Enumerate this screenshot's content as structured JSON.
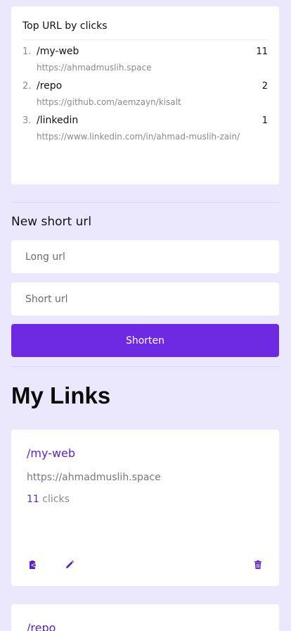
{
  "top_urls": {
    "title": "Top URL by clicks",
    "items": [
      {
        "rank": "1.",
        "path": "/my-web",
        "count": "11",
        "url": "https://ahmadmuslih.space"
      },
      {
        "rank": "2.",
        "path": "/repo",
        "count": "2",
        "url": "https://github.com/aemzayn/kisalt"
      },
      {
        "rank": "3.",
        "path": "/linkedin",
        "count": "1",
        "url": "https://www.linkedin.com/in/ahmad-muslih-zain/"
      }
    ]
  },
  "new_url": {
    "title": "New short url",
    "long_placeholder": "Long url",
    "short_placeholder": "Short url",
    "button_label": "Shorten"
  },
  "my_links": {
    "title": "My Links",
    "cards": [
      {
        "path": "/my-web",
        "url": "https://ahmadmuslih.space",
        "clicks": "11",
        "clicks_label": "clicks"
      },
      {
        "path": "/repo"
      }
    ]
  },
  "icons": {
    "copy": "clipboard-copy-icon",
    "edit": "pencil-icon",
    "delete": "trash-icon"
  },
  "colors": {
    "background": "#ebe7fd",
    "accent": "#6d2ae2",
    "link": "#5a23c8"
  }
}
